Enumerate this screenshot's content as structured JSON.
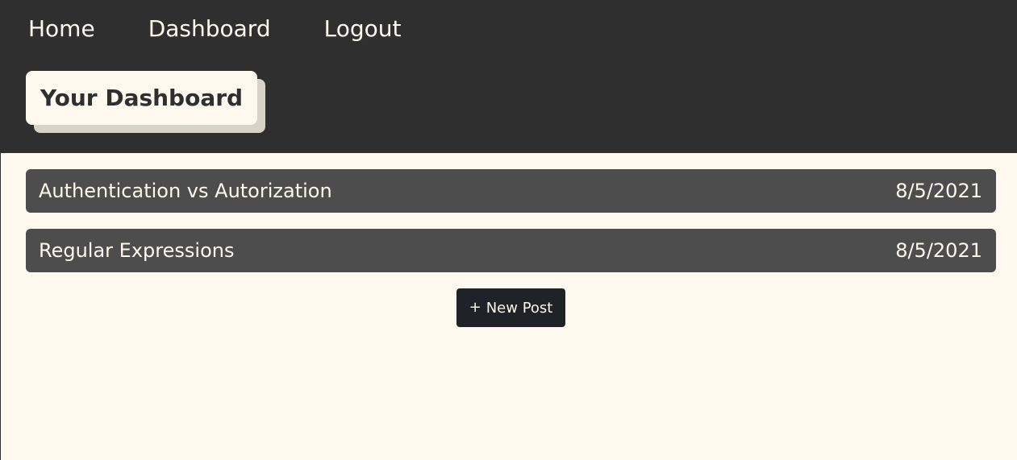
{
  "nav": {
    "home": "Home",
    "dashboard": "Dashboard",
    "logout": "Logout"
  },
  "page": {
    "title": "Your Dashboard"
  },
  "posts": [
    {
      "title": "Authentication vs Autorization",
      "date": "8/5/2021"
    },
    {
      "title": "Regular Expressions",
      "date": "8/5/2021"
    }
  ],
  "actions": {
    "new_post_icon": "+",
    "new_post_label": "New Post"
  },
  "colors": {
    "header_bg": "#2f2f2f",
    "page_bg": "#fdf9ef",
    "post_bg": "#4d4d4d",
    "button_bg": "#1f2227"
  }
}
